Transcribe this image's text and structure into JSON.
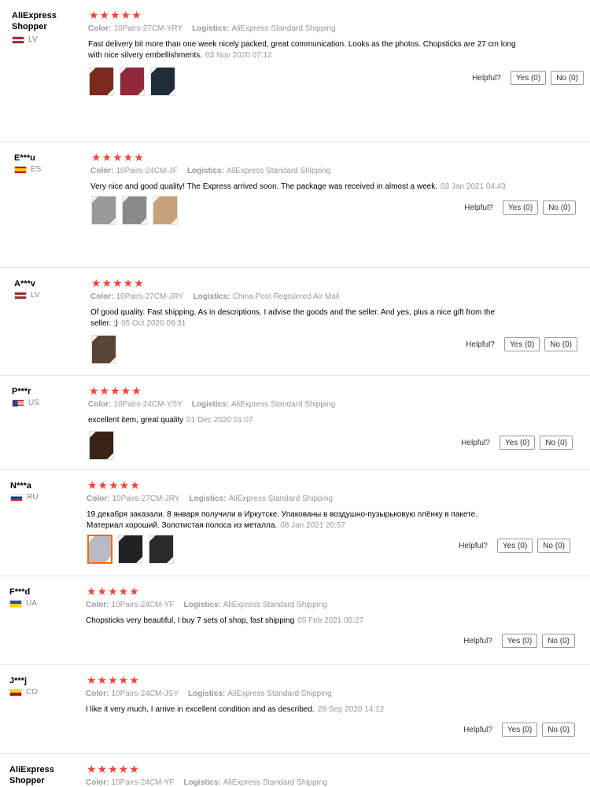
{
  "labels": {
    "color": "Color:",
    "logistics": "Logistics:",
    "helpful": "Helpful?",
    "stars": "★★★★★"
  },
  "reviews": [
    {
      "user": "AliExpress Shopper",
      "country": "LV",
      "flag": "lv",
      "color": "10Pairs-27CM-YRY",
      "logistics": "AliExpress Standard Shipping",
      "text": "Fast delivery bit more than one week nicely packed, great communication. Looks as the photos. Chopsticks are 27 cm long with nice silvery embellishments.",
      "date": "03 Nov 2020 07:12",
      "yes": "Yes (0)",
      "no": "No (0)",
      "thumbs": [
        "#7a2a1e",
        "#8e2a3a",
        "#1f2d3a"
      ]
    },
    {
      "user": "E***u",
      "country": "ES",
      "flag": "es",
      "color": "10Pairs-24CM-JF",
      "logistics": "AliExpress Standard Shipping",
      "text": "Very nice and good quality! The Express arrived soon. The package was received in almost a week.",
      "date": "03 Jan 2021 04:43",
      "yes": "Yes (0)",
      "no": "No (0)",
      "thumbs": [
        "#9a9a9a",
        "#8a8a8a",
        "#c8a27a"
      ]
    },
    {
      "user": "A***v",
      "country": "LV",
      "flag": "lv",
      "color": "10Pairs-27CM-JRY",
      "logistics": "China Post Registered Air Mail",
      "text": "Of good quality. Fast shipping. As in descriptions. I advise the goods and the seller. And yes, plus a nice gift from the seller. :)",
      "date": "05 Oct 2020 09:31",
      "yes": "Yes (0)",
      "no": "No (0)",
      "thumbs": [
        "#5a4636"
      ]
    },
    {
      "user": "P***r",
      "country": "US",
      "flag": "us",
      "color": "10Pairs-24CM-YSY",
      "logistics": "AliExpress Standard Shipping",
      "text": "excellent item, great quality",
      "date": "01 Dec 2020 01:07",
      "yes": "Yes (0)",
      "no": "No (0)",
      "thumbs": [
        "#3a2418"
      ]
    },
    {
      "user": "N***a",
      "country": "RU",
      "flag": "ru",
      "color": "10Pairs-27CM-JRY",
      "logistics": "AliExpress Standard Shipping",
      "text": "19 декабря заказали. 8 января получили в Иркутске. Упакованы в воздушно-пузырьковую плёнку в пакете. Материал хороший. Золотистая полоса из металла.",
      "date": "08 Jan 2021 20:57",
      "yes": "Yes (0)",
      "no": "No (0)",
      "thumbs": [
        "#b8bcc2",
        "#222222",
        "#2a2a2a"
      ]
    },
    {
      "user": "F***d",
      "country": "UA",
      "flag": "ua",
      "color": "10Pairs-24CM-YF",
      "logistics": "AliExpress Standard Shipping",
      "text": "Chopsticks very beautiful, I buy 7 sets of shop, fast shipping",
      "date": "05 Feb 2021 05:27",
      "yes": "Yes (0)",
      "no": "No (0)",
      "thumbs": []
    },
    {
      "user": "J***j",
      "country": "CO",
      "flag": "co",
      "color": "10Pairs-24CM-JSY",
      "logistics": "AliExpress Standard Shipping",
      "text": "I like it very much, I arrive in excellent condition and as described.",
      "date": "28 Sep 2020 14:12",
      "yes": "Yes (0)",
      "no": "No (0)",
      "thumbs": []
    },
    {
      "user": "AliExpress Shopper",
      "country": "",
      "flag": "",
      "color": "10Pairs-24CM-YF",
      "logistics": "AliExpress Standard Shipping",
      "text": "",
      "date": "",
      "yes": "",
      "no": "",
      "thumbs": []
    }
  ]
}
